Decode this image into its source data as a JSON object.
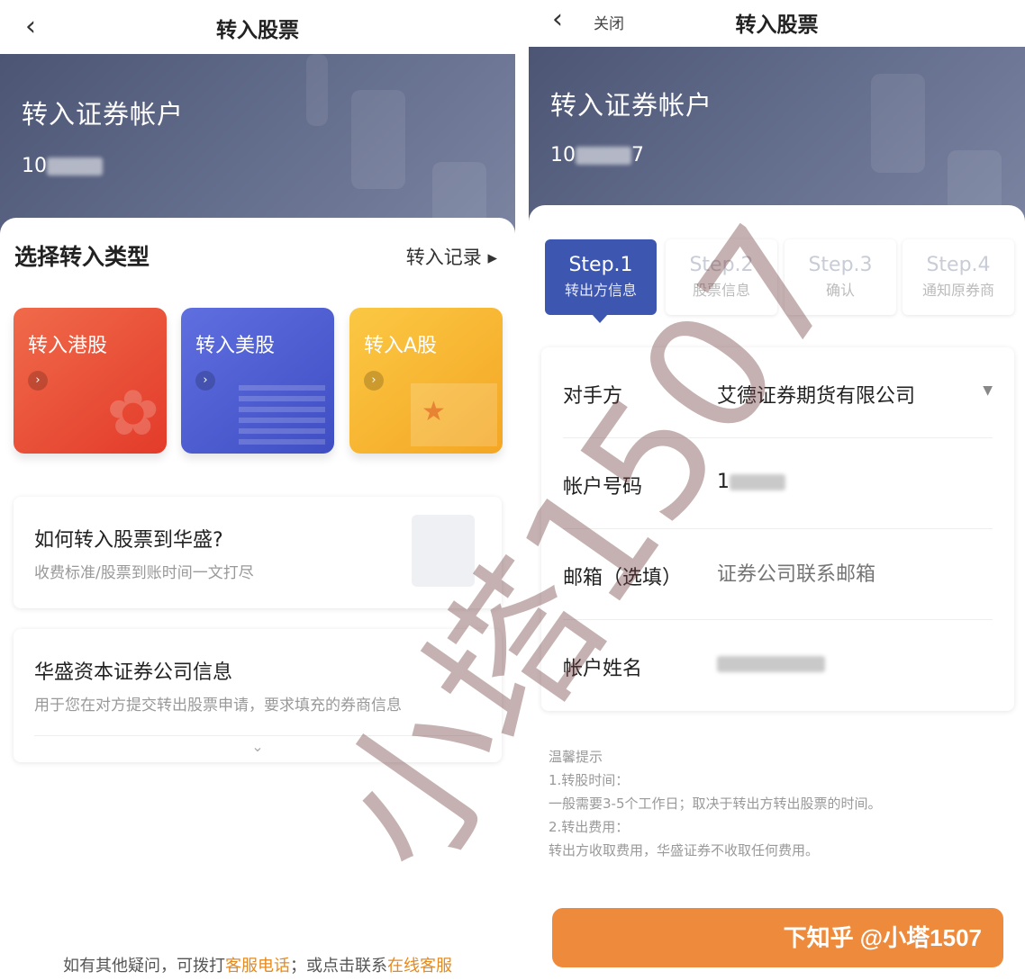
{
  "left": {
    "nav": {
      "title": "转入股票"
    },
    "hero": {
      "title": "转入证券帐户",
      "account_prefix": "10"
    },
    "section": {
      "title": "选择转入类型",
      "record_link": "转入记录 ▸"
    },
    "cards": [
      {
        "label": "转入港股",
        "color": "#e84a33"
      },
      {
        "label": "转入美股",
        "color": "#4656cd"
      },
      {
        "label": "转入A股",
        "color": "#f6b22e"
      }
    ],
    "faq": [
      {
        "title": "如何转入股票到华盛?",
        "subtitle": "收费标准/股票到账时间一文打尽"
      },
      {
        "title": "华盛资本证券公司信息",
        "subtitle": "用于您在对方提交转出股票申请，要求填充的券商信息"
      }
    ],
    "footer": {
      "prefix": "如有其他疑问，可拨打",
      "phone_link": "客服电话",
      "middle": "；或点击联系",
      "online_link": "在线客服"
    }
  },
  "right": {
    "nav": {
      "close": "关闭",
      "title": "转入股票"
    },
    "hero": {
      "title": "转入证券帐户",
      "account_prefix": "10",
      "account_suffix": "7"
    },
    "steps": [
      {
        "step": "Step.1",
        "label": "转出方信息",
        "active": true
      },
      {
        "step": "Step.2",
        "label": "股票信息",
        "active": false
      },
      {
        "step": "Step.3",
        "label": "确认",
        "active": false
      },
      {
        "step": "Step.4",
        "label": "通知原券商",
        "active": false
      }
    ],
    "form": {
      "counterparty_label": "对手方",
      "counterparty_value": "艾德证券期货有限公司",
      "account_label": "帐户号码",
      "account_value_prefix": "1",
      "email_label": "邮箱（选填）",
      "email_placeholder": "证券公司联系邮箱",
      "name_label": "帐户姓名"
    },
    "tips": {
      "heading": "温馨提示",
      "lines": [
        "1.转股时间：",
        "一般需要3-5个工作日；取决于转出方转出股票的时间。",
        "2.转出费用：",
        "转出方收取费用，华盛证券不收取任何费用。"
      ]
    },
    "next_button": "下知乎 @小塔1507"
  },
  "watermark": "小塔1507",
  "accent": "#ee8a3c",
  "step_active_color": "#3d56b0"
}
